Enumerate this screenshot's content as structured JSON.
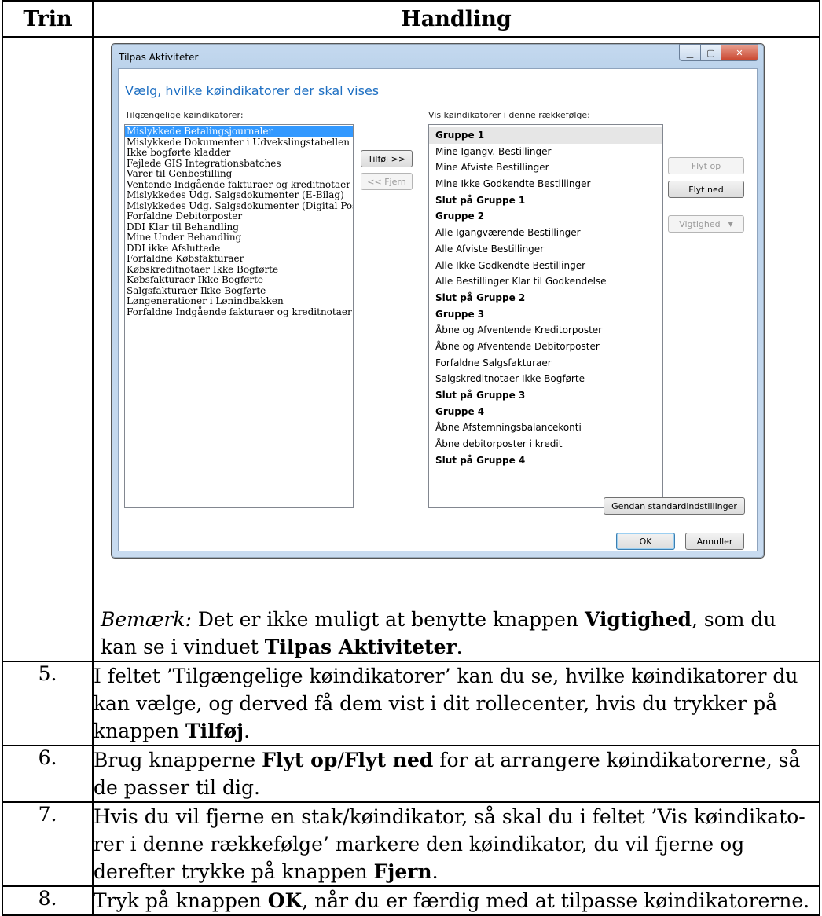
{
  "table": {
    "header_step": "Trin",
    "header_action": "Handling"
  },
  "dialog": {
    "title": "Tilpas Aktiviteter",
    "heading": "Vælg, hvilke køindikatorer der skal vises",
    "available_label": "Tilgængelige køindikatorer:",
    "order_label": "Vis køindikatorer i denne rækkefølge:",
    "available_items": [
      "Mislykkede Betalingsjournaler",
      "Mislykkede Dokumenter i Udvekslingstabellen",
      "Ikke bogførte kladder",
      "Fejlede GIS Integrationsbatches",
      "Varer til Genbestilling",
      "Ventende Indgående fakturaer og kreditnotaer",
      "Mislykkedes Udg. Salgsdokumenter (E-Bilag)",
      "Mislykkedes Udg. Salgsdokumenter (Digital Post)",
      "Forfaldne Debitorposter",
      "DDI Klar til Behandling",
      "Mine Under Behandling",
      "DDI ikke Afsluttede",
      "Forfaldne Købsfakturaer",
      "Købskreditnotaer Ikke Bogførte",
      "Købsfakturaer Ikke Bogførte",
      "Salgsfakturaer Ikke Bogførte",
      "Løngenerationer i Lønindbakken",
      "Forfaldne Indgående fakturaer og kreditnotaer"
    ],
    "order_items": [
      {
        "text": "Gruppe 1",
        "bold": true
      },
      {
        "text": "Mine Igangv. Bestillinger",
        "bold": false
      },
      {
        "text": "Mine Afviste Bestillinger",
        "bold": false
      },
      {
        "text": "Mine Ikke Godkendte Bestillinger",
        "bold": false
      },
      {
        "text": "Slut på Gruppe 1",
        "bold": true
      },
      {
        "text": "Gruppe 2",
        "bold": true
      },
      {
        "text": "Alle Igangværende Bestillinger",
        "bold": false
      },
      {
        "text": "Alle Afviste Bestillinger",
        "bold": false
      },
      {
        "text": "Alle Ikke Godkendte Bestillinger",
        "bold": false
      },
      {
        "text": "Alle Bestillinger Klar til Godkendelse",
        "bold": false
      },
      {
        "text": "Slut på Gruppe 2",
        "bold": true
      },
      {
        "text": "Gruppe 3",
        "bold": true
      },
      {
        "text": "Åbne og Afventende Kreditorposter",
        "bold": false
      },
      {
        "text": "Åbne og Afventende Debitorposter",
        "bold": false
      },
      {
        "text": "Forfaldne Salgsfakturaer",
        "bold": false
      },
      {
        "text": "Salgskreditnotaer Ikke Bogførte",
        "bold": false
      },
      {
        "text": "Slut på Gruppe 3",
        "bold": true
      },
      {
        "text": "Gruppe 4",
        "bold": true
      },
      {
        "text": "Åbne Afstemningsbalancekonti",
        "bold": false
      },
      {
        "text": "Åbne debitorposter i kredit",
        "bold": false
      },
      {
        "text": "Slut på Gruppe 4",
        "bold": true
      }
    ],
    "add_button": "Tilføj >>",
    "remove_button": "<< Fjern",
    "move_up_button": "Flyt op",
    "move_down_button": "Flyt ned",
    "importance_button": "Vigtighed",
    "restore_button": "Gendan standardindstillinger",
    "ok_button": "OK",
    "cancel_button": "Annuller"
  },
  "note": {
    "prefix": "Bemærk:",
    "text1": " Det er ikke muligt at benytte knappen ",
    "bold1": "Vigtighed",
    "text2": ", som du kan se i vinduet ",
    "bold2": "Tilpas Aktiviteter",
    "text3": "."
  },
  "steps": [
    {
      "num": "5.",
      "parts": [
        {
          "t": "I feltet ’Tilgængelige køindikatorer’ kan du se, hvilke køindikatorer du kan vælge, og derved få dem vist i dit rollecenter, hvis du trykker på knappen ",
          "b": false
        },
        {
          "t": "Tilføj",
          "b": true
        },
        {
          "t": ".",
          "b": false
        }
      ]
    },
    {
      "num": "6.",
      "parts": [
        {
          "t": "Brug knapperne ",
          "b": false
        },
        {
          "t": "Flyt op",
          "b": true
        },
        {
          "t": "/",
          "b": false
        },
        {
          "t": "Flyt ned",
          "b": true
        },
        {
          "t": " for at arrangere køindikatorerne, så de passer til dig.",
          "b": false
        }
      ]
    },
    {
      "num": "7.",
      "parts": [
        {
          "t": "Hvis du vil fjerne en stak/køindikator, så skal du i feltet ’Vis køindikato-rer i denne rækkefølge’ markere den køindikator, du vil fjerne og derefter trykke på knappen ",
          "b": false
        },
        {
          "t": "Fjern",
          "b": true
        },
        {
          "t": ".",
          "b": false
        }
      ]
    },
    {
      "num": "8.",
      "parts": [
        {
          "t": "Tryk på knappen ",
          "b": false
        },
        {
          "t": "OK",
          "b": true
        },
        {
          "t": ", når du er færdig med at tilpasse køindikatorerne.",
          "b": false
        }
      ]
    }
  ]
}
